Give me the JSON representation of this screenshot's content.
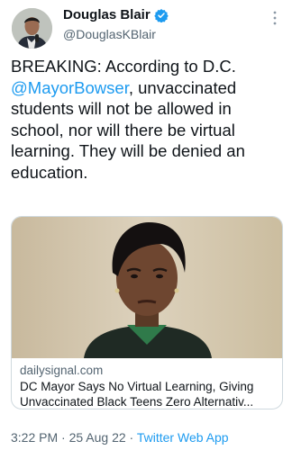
{
  "author": {
    "name": "Douglas Blair",
    "handle": "@DouglasKBlair",
    "verified": true
  },
  "tweet": {
    "text_before": "BREAKING: According to D.C. ",
    "mention": "@MayorBowser",
    "text_after": ", unvaccinated students will not be allowed in school, nor will there be virtual learning. They will be denied an education."
  },
  "card": {
    "domain": "dailysignal.com",
    "title": "DC Mayor Says No Virtual Learning, Giving Unvaccinated Black Teens Zero Alternativ..."
  },
  "meta": {
    "time": "3:22 PM",
    "separator": "·",
    "date": "25 Aug 22",
    "source": "Twitter Web App"
  },
  "colors": {
    "accent": "#1d9bf0",
    "text": "#0f1419",
    "secondary": "#536471",
    "border": "#cfd9de"
  },
  "icons": {
    "verified": "verified-badge-icon",
    "more": "more-options-icon"
  }
}
